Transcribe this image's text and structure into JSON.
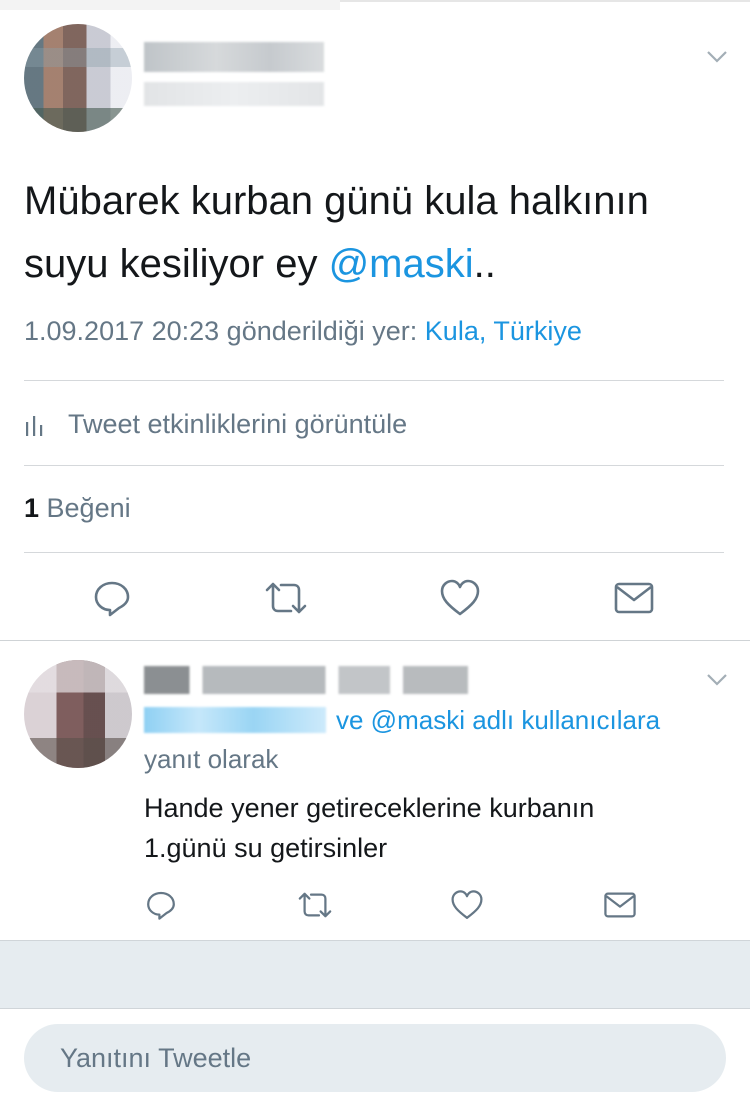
{
  "main_tweet": {
    "text_plain": "Mübarek kurban günü kula halkının suyu kesiliyor ey ",
    "mention": "@maski",
    "text_suffix": "..",
    "timestamp": "1.09.2017 20:23 gönderildiği yer: ",
    "location": "Kula, Türkiye",
    "analytics_label": "Tweet etkinliklerini görüntüle",
    "likes_count": "1",
    "likes_label": " Beğeni"
  },
  "reply": {
    "reply_to_suffix": "ve @maski adlı kullanıcılara",
    "reply_as": "yanıt olarak",
    "text_line1": "Hande yener getireceklerine kurbanın",
    "text_line2": "1.günü su getirsinler"
  },
  "composer": {
    "placeholder": "Yanıtını Tweetle"
  },
  "icons": {
    "reply": "reply-icon",
    "retweet": "retweet-icon",
    "like": "heart-icon",
    "dm": "envelope-icon",
    "more": "chevron-down-icon",
    "analytics": "bar-chart-icon"
  },
  "colors": {
    "link": "#1b95e0",
    "secondary_text": "#657786",
    "primary_text": "#14171a",
    "icon": "#657786",
    "composer_bg": "#e6ecf0"
  }
}
